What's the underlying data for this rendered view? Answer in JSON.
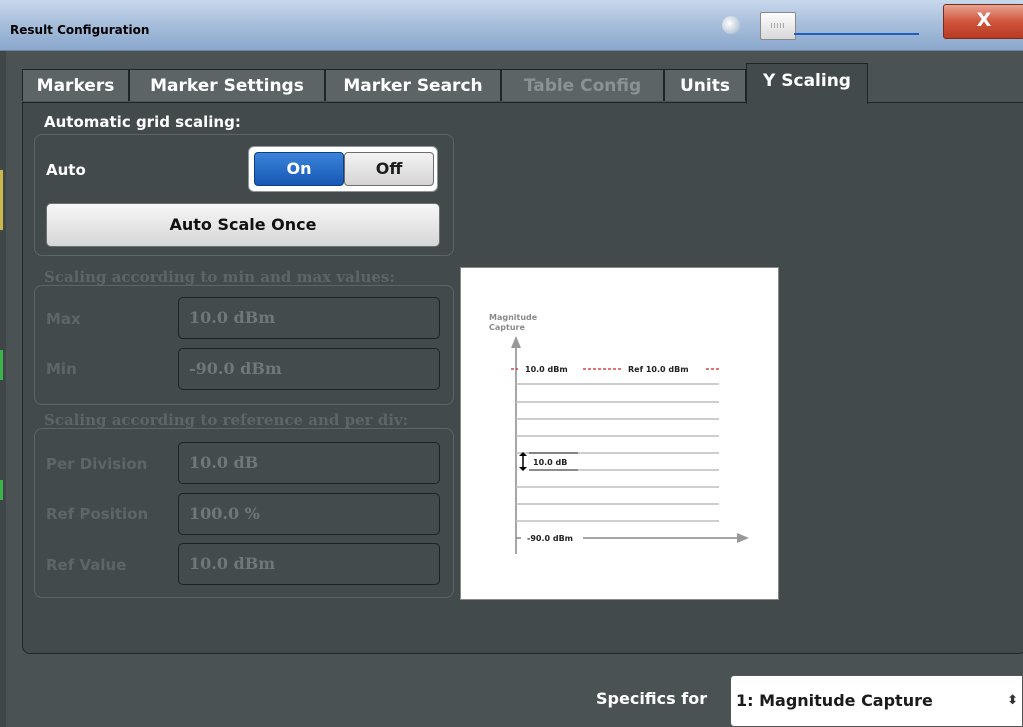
{
  "window": {
    "title": "Result Configuration",
    "close_label": "X"
  },
  "tabs": [
    {
      "label": "Markers",
      "state": "normal"
    },
    {
      "label": "Marker Settings",
      "state": "normal"
    },
    {
      "label": "Marker Search",
      "state": "normal"
    },
    {
      "label": "Table Config",
      "state": "disabled"
    },
    {
      "label": "Units",
      "state": "normal"
    },
    {
      "label": "Y Scaling",
      "state": "active"
    }
  ],
  "auto_section": {
    "heading": "Automatic grid scaling:",
    "auto_label": "Auto",
    "toggle": {
      "on": "On",
      "off": "Off",
      "selected": "On"
    },
    "auto_scale_once": "Auto Scale Once"
  },
  "minmax_section": {
    "heading": "Scaling according to min and max values:",
    "max_label": "Max",
    "max_value": "10.0 dBm",
    "min_label": "Min",
    "min_value": "-90.0 dBm"
  },
  "ref_section": {
    "heading": "Scaling according to reference and per div:",
    "per_division_label": "Per Division",
    "per_division_value": "10.0 dB",
    "ref_position_label": "Ref Position",
    "ref_position_value": "100.0 %",
    "ref_value_label": "Ref Value",
    "ref_value_value": "10.0 dBm"
  },
  "diagram": {
    "axis_title_1": "Magnitude",
    "axis_title_2": "Capture",
    "top_value": "10.0 dBm",
    "ref_label": "Ref 10.0 dBm",
    "division_label": "10.0 dB",
    "bottom_value": "-90.0 dBm"
  },
  "footer": {
    "specifics_label": "Specifics for",
    "specifics_value": "1: Magnitude Capture",
    "select_arrow": "⬍"
  },
  "colors": {
    "accent": "#1558b5",
    "close": "#c8442b",
    "panel": "#424a4c",
    "ref_line": "#d42020"
  }
}
